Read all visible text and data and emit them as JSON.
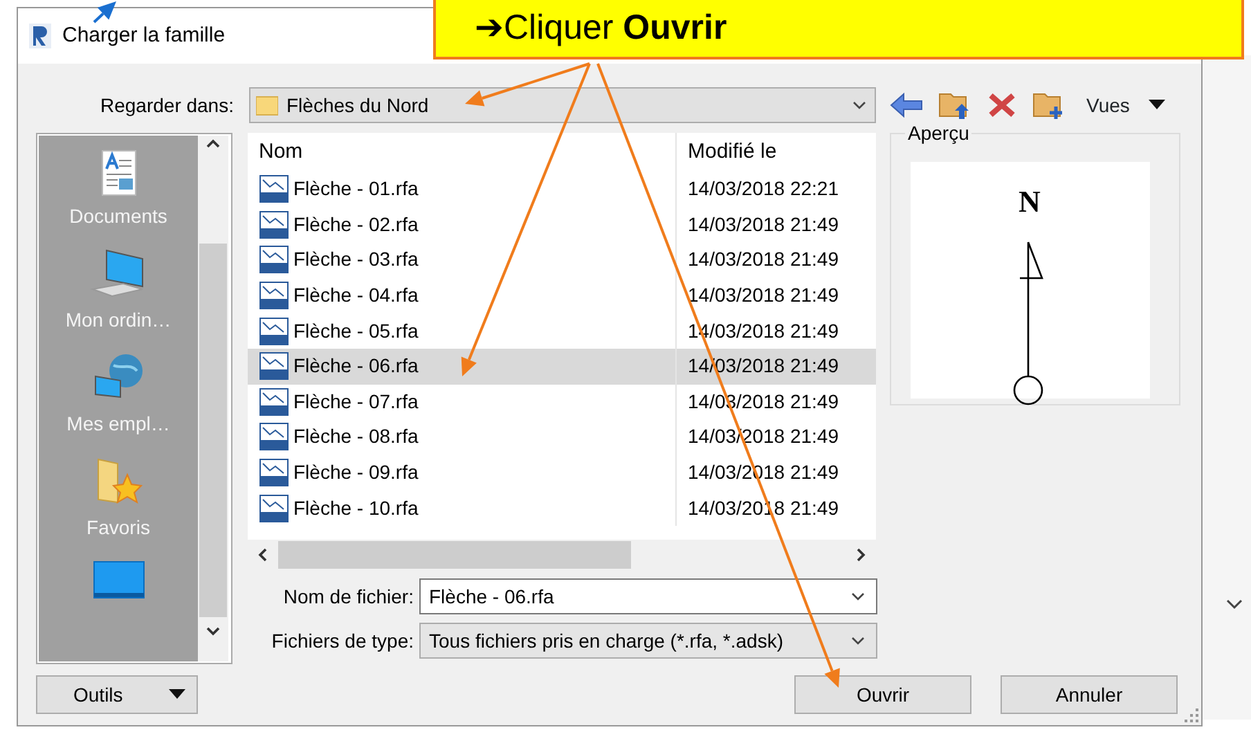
{
  "window": {
    "title": "Charger la famille"
  },
  "callout": {
    "text": "➔Cliquer **Ouvrir**"
  },
  "look_in": {
    "label": "Regarder dans:",
    "value": "Flèches du Nord"
  },
  "toolbar": {
    "views": "Vues"
  },
  "places": [
    {
      "label": "Documents",
      "kind": "documents"
    },
    {
      "label": "Mon ordin…",
      "kind": "computer"
    },
    {
      "label": "Mes empl…",
      "kind": "network"
    },
    {
      "label": "Favoris",
      "kind": "favorites"
    },
    {
      "kind": "desktop"
    }
  ],
  "columns": [
    "Nom",
    "Modifié le"
  ],
  "files": [
    {
      "name": "Flèche - 01.rfa",
      "modified": "14/03/2018 22:21",
      "selected": false
    },
    {
      "name": "Flèche - 02.rfa",
      "modified": "14/03/2018 21:49",
      "selected": false
    },
    {
      "name": "Flèche - 03.rfa",
      "modified": "14/03/2018 21:49",
      "selected": false
    },
    {
      "name": "Flèche - 04.rfa",
      "modified": "14/03/2018 21:49",
      "selected": false
    },
    {
      "name": "Flèche - 05.rfa",
      "modified": "14/03/2018 21:49",
      "selected": false
    },
    {
      "name": "Flèche - 06.rfa",
      "modified": "14/03/2018 21:49",
      "selected": true
    },
    {
      "name": "Flèche - 07.rfa",
      "modified": "14/03/2018 21:49",
      "selected": false
    },
    {
      "name": "Flèche - 08.rfa",
      "modified": "14/03/2018 21:49",
      "selected": false
    },
    {
      "name": "Flèche - 09.rfa",
      "modified": "14/03/2018 21:49",
      "selected": false
    },
    {
      "name": "Flèche - 10.rfa",
      "modified": "14/03/2018 21:49",
      "selected": false
    }
  ],
  "preview": {
    "label": "Aperçu",
    "symbol": "N"
  },
  "file_name": {
    "label": "Nom de fichier:",
    "value": "Flèche - 06.rfa"
  },
  "file_type": {
    "label": "Fichiers de type:",
    "value": "Tous fichiers pris en charge  (*.rfa, *.adsk)"
  },
  "buttons": [
    {
      "label": "Outils",
      "kind": "menu"
    },
    {
      "label": "Ouvrir",
      "kind": "plain"
    },
    {
      "label": "Annuler",
      "kind": "plain"
    }
  ]
}
